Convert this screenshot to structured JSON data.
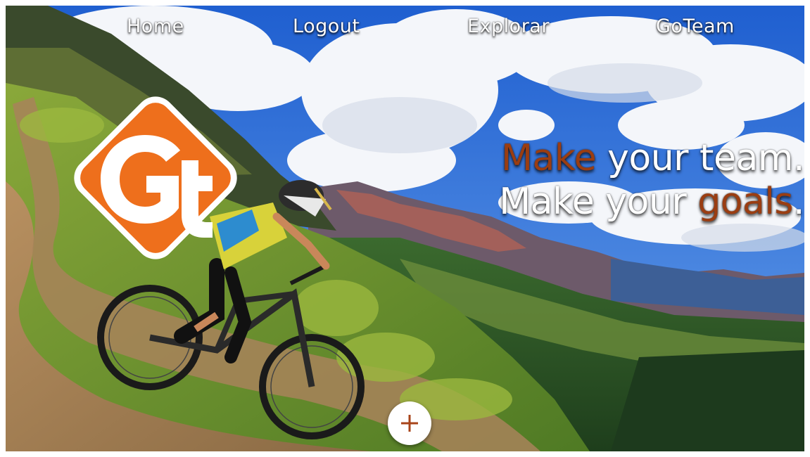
{
  "nav": {
    "home": "Home",
    "logout": "Logout",
    "explorar": "Explorar",
    "goteam": "GoTeam"
  },
  "hero": {
    "line1_accent": "Make",
    "line1_rest": " your team.",
    "line2_start": "Make your ",
    "line2_accent": "goals",
    "line2_end": "."
  },
  "colors": {
    "brand_orange": "#ee6f1c",
    "accent_text": "#9a3d12",
    "plus_icon": "#a8441a"
  },
  "icons": {
    "logo": "goteam-logo",
    "fab": "plus-icon"
  }
}
